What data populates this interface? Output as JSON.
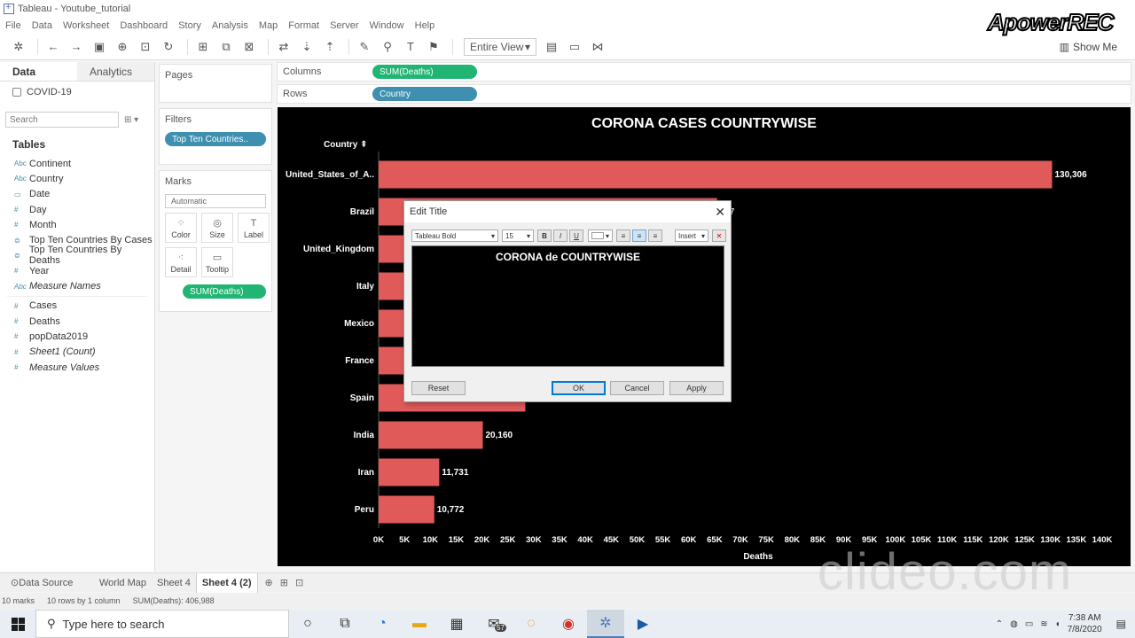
{
  "window": {
    "title": "Tableau - Youtube_tutorial"
  },
  "menu": [
    "File",
    "Data",
    "Worksheet",
    "Dashboard",
    "Story",
    "Analysis",
    "Map",
    "Format",
    "Server",
    "Window",
    "Help"
  ],
  "toolbar": {
    "view_mode": "Entire View",
    "show_me": "Show Me"
  },
  "data_panel": {
    "tab_data": "Data",
    "tab_analytics": "Analytics",
    "datasource": "COVID-19",
    "search_placeholder": "Search",
    "tables_heading": "Tables",
    "fields": [
      {
        "type": "Abc",
        "name": "Continent"
      },
      {
        "type": "Abc",
        "name": "Country"
      },
      {
        "type": "date",
        "name": "Date"
      },
      {
        "type": "#",
        "name": "Day"
      },
      {
        "type": "#",
        "name": "Month"
      },
      {
        "type": "set",
        "name": "Top Ten Countries By Cases"
      },
      {
        "type": "set",
        "name": "Top Ten Countries By Deaths"
      },
      {
        "type": "#",
        "name": "Year"
      },
      {
        "type": "Abc",
        "name": "Measure Names"
      },
      {
        "type": "#",
        "name": "Cases"
      },
      {
        "type": "#",
        "name": "Deaths"
      },
      {
        "type": "#",
        "name": "popData2019"
      },
      {
        "type": "#",
        "name": "Sheet1 (Count)"
      },
      {
        "type": "#",
        "name": "Measure Values"
      }
    ]
  },
  "shelves": {
    "pages": "Pages",
    "filters": "Filters",
    "filter_pill": "Top Ten Countries..",
    "marks": "Marks",
    "mark_type": "Automatic",
    "mark_cards": [
      "Color",
      "Size",
      "Label",
      "Detail",
      "Tooltip"
    ],
    "marks_pill": "SUM(Deaths)",
    "columns_label": "Columns",
    "columns_pill": "SUM(Deaths)",
    "rows_label": "Rows",
    "rows_pill": "Country"
  },
  "viz": {
    "title": "CORONA CASES COUNTRYWISE",
    "row_header": "Country",
    "x_axis_label": "Deaths",
    "bar_color": "#e05a5a"
  },
  "chart_data": {
    "type": "bar",
    "orientation": "horizontal",
    "title": "CORONA CASES COUNTRYWISE",
    "xlabel": "Deaths",
    "ylabel": "Country",
    "categories": [
      "United_States_of_A..",
      "Brazil",
      "United_Kingdom",
      "Italy",
      "Mexico",
      "France",
      "Spain",
      "India",
      "Iran",
      "Peru"
    ],
    "values": [
      130306,
      65487,
      44391,
      34869,
      31119,
      29896,
      28385,
      20160,
      11731,
      10772
    ],
    "labels": [
      "130,306",
      "487",
      "",
      "",
      "",
      "",
      "",
      "20,160",
      "11,731",
      "10,772"
    ],
    "xlim": [
      0,
      140000
    ],
    "xticks": [
      "0K",
      "5K",
      "10K",
      "15K",
      "20K",
      "25K",
      "30K",
      "35K",
      "40K",
      "45K",
      "50K",
      "55K",
      "60K",
      "65K",
      "70K",
      "75K",
      "80K",
      "85K",
      "90K",
      "95K",
      "100K",
      "105K",
      "110K",
      "115K",
      "120K",
      "125K",
      "130K",
      "135K",
      "140K"
    ],
    "grid": false,
    "background": "#000000"
  },
  "dialog": {
    "title": "Edit Title",
    "font": "Tableau Bold",
    "size": "15",
    "insert_label": "Insert",
    "editor_text": "CORONA de COUNTRYWISE",
    "reset": "Reset",
    "ok": "OK",
    "cancel": "Cancel",
    "apply": "Apply"
  },
  "sheet_tabs": [
    "Data Source",
    "World Map",
    "Sheet 4",
    "Sheet 4 (2)"
  ],
  "active_sheet": "Sheet 4 (2)",
  "status": {
    "marks": "10 marks",
    "dims": "10 rows by 1 column",
    "sum": "SUM(Deaths): 406,988"
  },
  "taskbar": {
    "search_placeholder": "Type here to search",
    "mail_badge": "57",
    "time": "7:38 AM",
    "date": "7/8/2020"
  },
  "watermarks": {
    "top": "ApowerREC",
    "bottom": "clideo.com"
  }
}
